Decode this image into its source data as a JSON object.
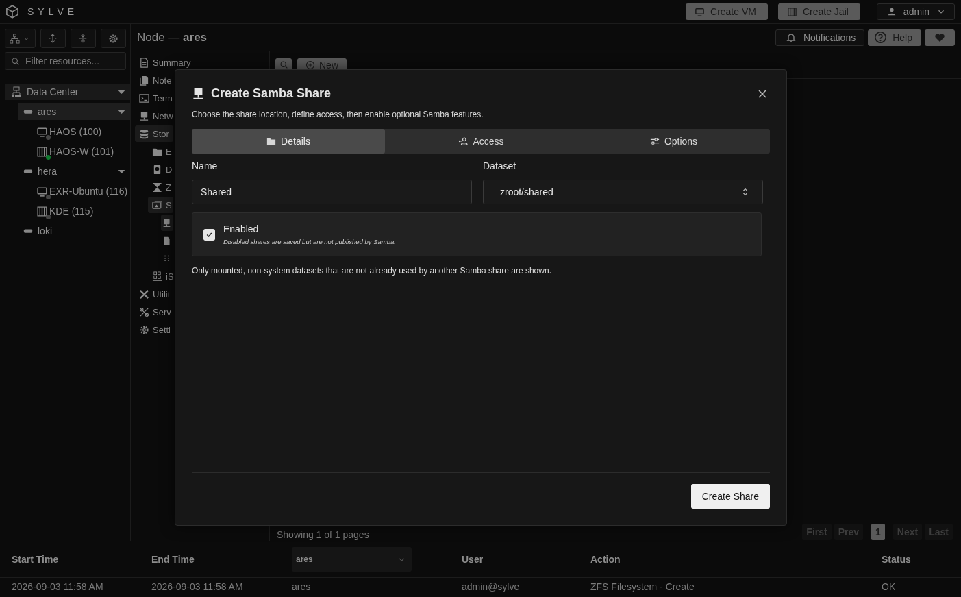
{
  "brand": {
    "name": "SYLVE"
  },
  "top_actions": [
    {
      "label": "Create VM",
      "kind": "vm"
    },
    {
      "label": "Create Jail",
      "kind": "jail"
    }
  ],
  "user_menu": {
    "label": "admin"
  },
  "sidebar": {
    "filter": {
      "placeholder": "Filter resources..."
    },
    "tree": [
      {
        "label": "Data Center",
        "kind": "datacenter",
        "expanded": true,
        "selected": true,
        "children": [
          {
            "label": "ares",
            "kind": "node",
            "expanded": true,
            "selected": true,
            "children": [
              {
                "label": "HAOS (100)",
                "kind": "vm",
                "running": false,
                "selected": false
              },
              {
                "label": "HAOS-W (101)",
                "kind": "jail",
                "running": true,
                "selected": false
              }
            ]
          },
          {
            "label": "hera",
            "kind": "node",
            "expanded": true,
            "selected": false,
            "children": [
              {
                "label": "EXR-Ubuntu (116)",
                "kind": "vm",
                "running": false,
                "selected": false
              },
              {
                "label": "KDE (115)",
                "kind": "jail",
                "running": false,
                "selected": false
              }
            ]
          },
          {
            "label": "loki",
            "kind": "node",
            "selected": false
          }
        ]
      }
    ]
  },
  "breadcrumb": "Node — **ares**",
  "header_actions": [
    {
      "label": "Notifications",
      "kind": "bell"
    },
    {
      "label": "Help",
      "kind": "help"
    },
    {
      "kind": "heart"
    }
  ],
  "nav": [
    {
      "label": "Summary",
      "kind": "doc",
      "selected": false
    },
    {
      "label": "Note",
      "kind": "notes",
      "selected": false
    },
    {
      "label": "Term",
      "kind": "terminal",
      "selected": false
    },
    {
      "label": "Netw",
      "kind": "network",
      "selected": false
    },
    {
      "label": "Stor",
      "kind": "database",
      "selected": true,
      "children": [
        {
          "label": "E",
          "kind": "folder",
          "selected": false
        },
        {
          "label": "D",
          "kind": "disk",
          "selected": false
        },
        {
          "label": "Z",
          "kind": "zfs",
          "selected": false
        },
        {
          "label": "S",
          "kind": "share",
          "selected": true,
          "children": [
            {
              "kind": "network",
              "selected": true
            },
            {
              "kind": "file",
              "selected": false
            },
            {
              "kind": "dots",
              "selected": false
            }
          ]
        },
        {
          "label": "iS",
          "kind": "iscsi",
          "selected": false
        }
      ]
    },
    {
      "label": "Utilit",
      "kind": "tools",
      "selected": false
    },
    {
      "label": "Serv",
      "kind": "services",
      "selected": false
    },
    {
      "label": "Setti",
      "kind": "gear",
      "selected": false
    }
  ],
  "toolbar": {
    "new_label": "New"
  },
  "pagination": {
    "summary": "Showing 1 of 1 pages",
    "buttons": [
      {
        "label": "First",
        "selected": false
      },
      {
        "label": "Prev",
        "selected": false
      },
      {
        "label": "1",
        "selected": true
      },
      {
        "label": "Next",
        "selected": false
      },
      {
        "label": "Last",
        "selected": false
      }
    ]
  },
  "dialog": {
    "title": "Create Samba Share",
    "description": "Choose the share location, define access, then enable optional Samba features.",
    "tabs": [
      {
        "label": "Details",
        "kind": "folder",
        "selected": true
      },
      {
        "label": "Access",
        "kind": "access",
        "selected": false
      },
      {
        "label": "Options",
        "kind": "sliders",
        "selected": false
      }
    ],
    "name_field": {
      "label": "Name",
      "value": "Shared"
    },
    "dataset_field": {
      "label": "Dataset",
      "value": "zroot/shared"
    },
    "enabled": {
      "label": "Enabled",
      "hint": "Disabled shares are saved but are not published by Samba.",
      "checked": true
    },
    "note": "Only mounted, non-system datasets that are not already used by another Samba share are shown.",
    "submit": "Create Share"
  },
  "log_table": {
    "columns": [
      {
        "kind": "text",
        "label": "Start Time"
      },
      {
        "kind": "text",
        "label": "End Time"
      },
      {
        "kind": "select",
        "value": "ares"
      },
      {
        "kind": "text",
        "label": "User"
      },
      {
        "kind": "text",
        "label": "Action"
      },
      {
        "kind": "text",
        "label": "Status"
      }
    ],
    "rows": [
      [
        "2026-09-03 11:58 AM",
        "2026-09-03 11:58 AM",
        "ares",
        "admin@sylve",
        "ZFS Filesystem - Create",
        "OK"
      ]
    ]
  }
}
